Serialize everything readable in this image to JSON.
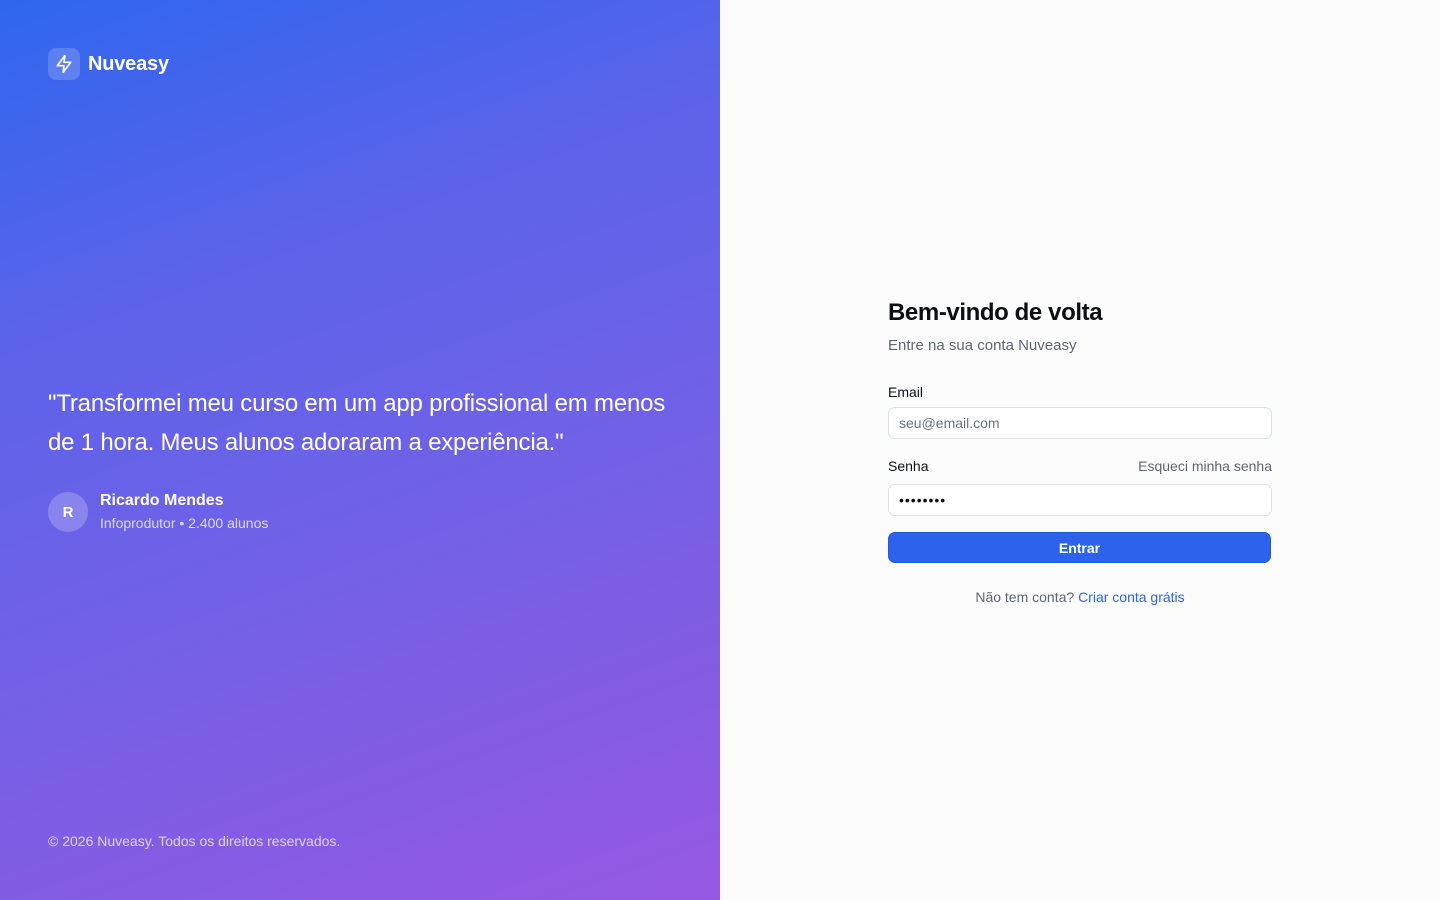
{
  "brand": {
    "name": "Nuveasy",
    "icon": "lightning-bolt-icon"
  },
  "testimonial": {
    "quote": "\"Transformei meu curso em um app profissional em menos de 1 hora. Meus alunos adoraram a experiência.\"",
    "avatar_initial": "R",
    "author_name": "Ricardo Mendes",
    "author_role": "Infoprodutor • 2.400 alunos"
  },
  "footer": {
    "copyright": "© 2026 Nuveasy. Todos os direitos reservados."
  },
  "login": {
    "title": "Bem-vindo de volta",
    "subtitle": "Entre na sua conta Nuveasy",
    "email_label": "Email",
    "email_placeholder": "seu@email.com",
    "password_label": "Senha",
    "password_value": "••••••••",
    "forgot_link": "Esqueci minha senha",
    "submit_label": "Entrar",
    "signup_prompt": "Não tem conta?",
    "signup_link": "Criar conta grátis"
  },
  "colors": {
    "accent": "#2d63ec",
    "gradient_start": "#2f66ee",
    "gradient_end": "#9658e2"
  }
}
